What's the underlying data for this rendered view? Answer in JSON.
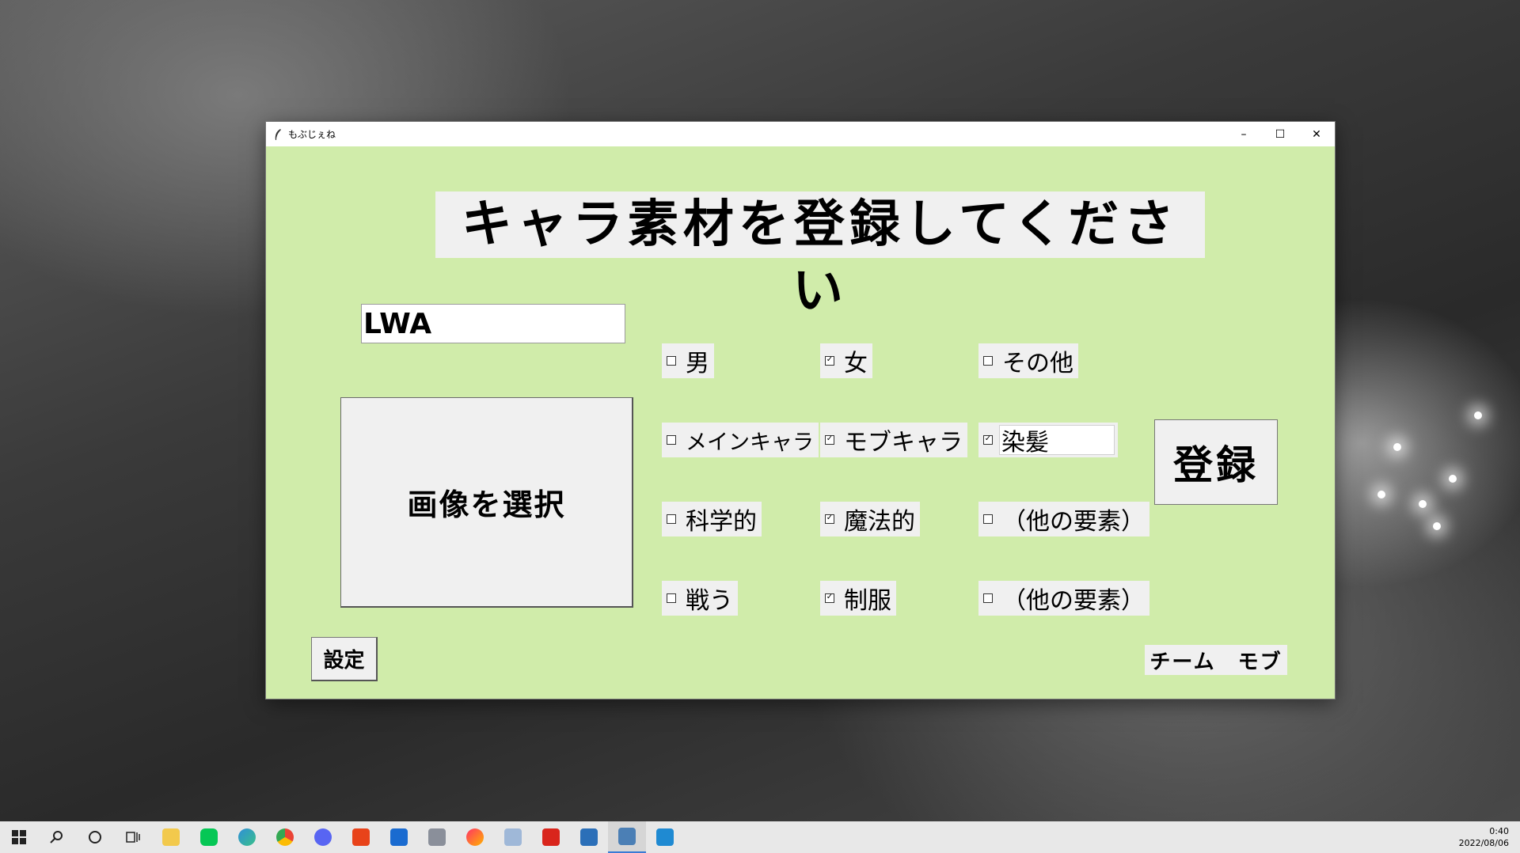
{
  "window": {
    "title": "もぶじぇね",
    "controls": {
      "minimize": "–",
      "maximize": "☐",
      "close": "✕"
    }
  },
  "heading": "キャラ素材を登録してください",
  "name_input": {
    "value": "LWA"
  },
  "select_image_button": "画像を選択",
  "checkboxes": [
    {
      "label": "男",
      "checked": false
    },
    {
      "label": "女",
      "checked": true
    },
    {
      "label": "その他",
      "checked": false
    },
    {
      "label": "メインキャラ",
      "checked": false
    },
    {
      "label": "モブキャラ",
      "checked": true
    },
    {
      "label": "",
      "checked": true,
      "entry_value": "染髪"
    },
    {
      "label": "科学的",
      "checked": false
    },
    {
      "label": "魔法的",
      "checked": true
    },
    {
      "label": "（他の要素）",
      "checked": false
    },
    {
      "label": "戦う",
      "checked": false
    },
    {
      "label": "制服",
      "checked": true
    },
    {
      "label": "（他の要素）",
      "checked": false
    }
  ],
  "register_button": "登録",
  "settings_button": "設定",
  "team_label": "チーム　モブ",
  "taskbar": {
    "icons": [
      "windows-start-icon",
      "search-icon",
      "cortana-icon",
      "task-view-icon",
      "file-explorer-icon",
      "line-icon",
      "edge-icon",
      "chrome-icon",
      "discord-icon",
      "office-icon",
      "mail-icon",
      "calculator-icon",
      "creative-cloud-icon",
      "app-icon",
      "acrobat-icon",
      "photos-icon",
      "python-app-icon",
      "vscode-icon"
    ],
    "time": "0:40",
    "date": "2022/08/06"
  }
}
